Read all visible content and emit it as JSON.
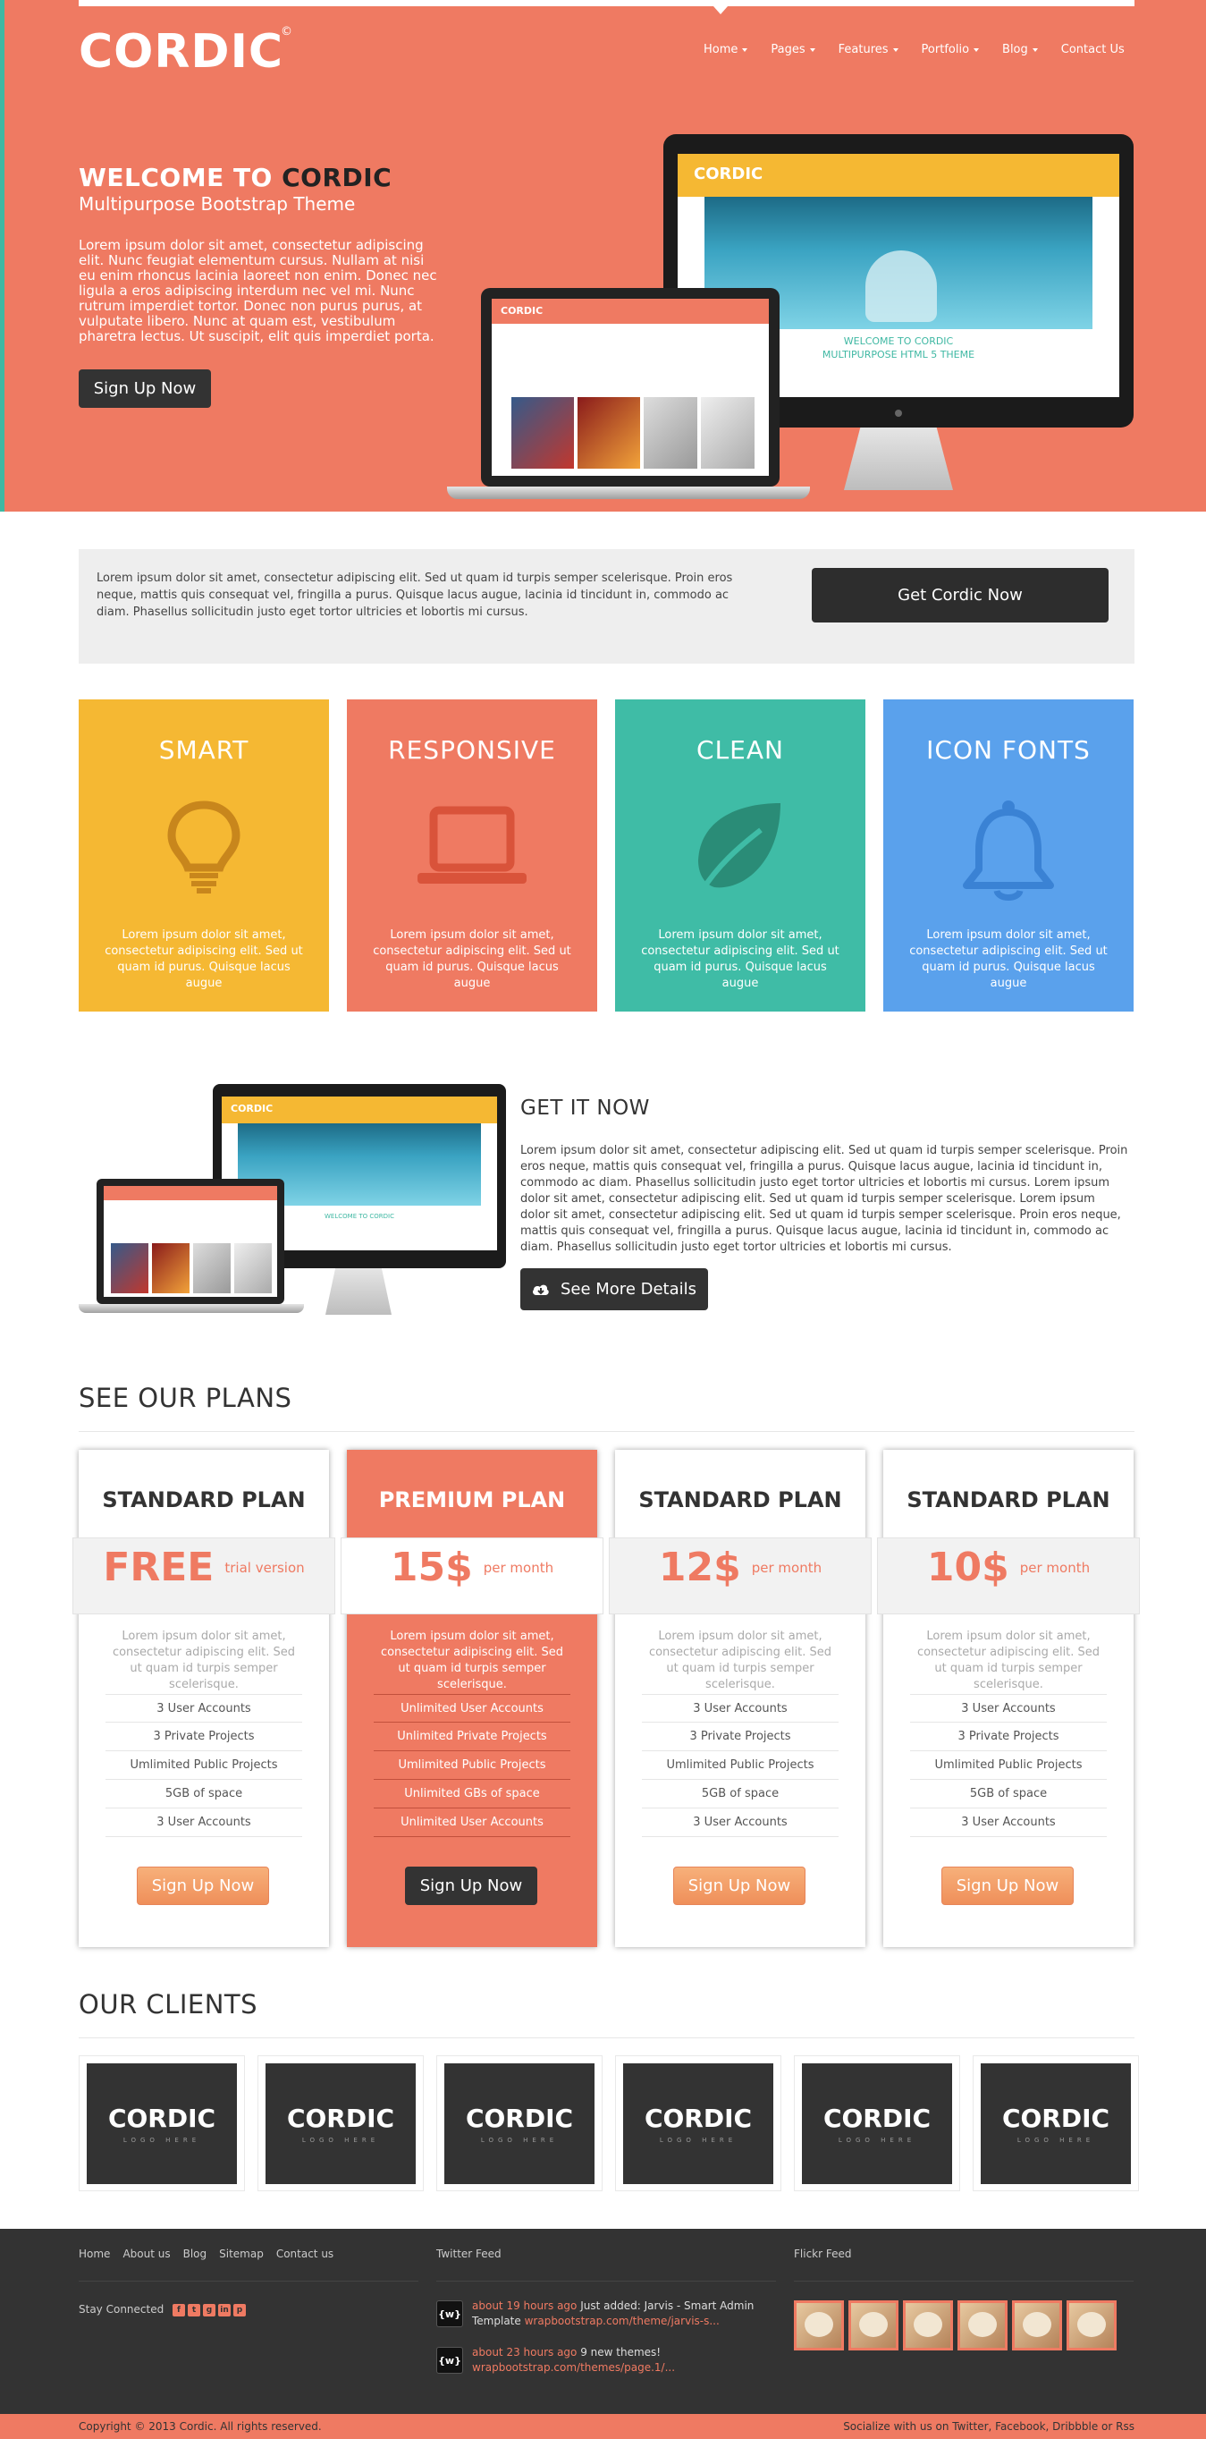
{
  "nav": {
    "logo": "CORDIC",
    "logo_mark": "©",
    "items": [
      {
        "label": "Home",
        "dropdown": true
      },
      {
        "label": "Pages",
        "dropdown": true
      },
      {
        "label": "Features",
        "dropdown": true
      },
      {
        "label": "Portfolio",
        "dropdown": true
      },
      {
        "label": "Blog",
        "dropdown": true
      },
      {
        "label": "Contact Us",
        "dropdown": false
      }
    ]
  },
  "hero": {
    "title_prefix": "WELCOME TO ",
    "title_brand": "CORDIC",
    "subtitle": "Multipurpose Bootstrap Theme",
    "body": "Lorem ipsum dolor sit amet, consectetur adipiscing elit. Nunc feugiat elementum cursus. Nullam at nisi eu enim rhoncus lacinia laoreet non enim. Donec nec ligula a eros adipiscing interdum nec vel mi. Nunc rutrum imperdiet tortor. Donec non purus purus, at vulputate libero. Nunc at quam est, vestibulum pharetra lectus. Ut suscipit, elit quis imperdiet porta.",
    "button": "Sign Up Now",
    "screen_brand": "CORDIC",
    "screen_caption_1": "WELCOME TO CORDIC",
    "screen_caption_2": "MULTIPURPOSE HTML 5 THEME"
  },
  "cta": {
    "text": "Lorem ipsum dolor sit amet, consectetur adipiscing elit. Sed ut quam id turpis semper scelerisque. Proin eros neque, mattis quis consequat vel, fringilla a purus. Quisque lacus augue, lacinia id tincidunt in, commodo ac diam. Phasellus sollicitudin justo eget tortor ultricies et lobortis mi cursus.",
    "button": "Get Cordic Now"
  },
  "features": [
    {
      "title": "SMART",
      "icon": "lightbulb-icon",
      "color": "#f5b833",
      "icon_color": "#c8861c",
      "body": "Lorem ipsum dolor sit amet, consectetur adipiscing elit. Sed ut quam id purus. Quisque lacus augue"
    },
    {
      "title": "RESPONSIVE",
      "icon": "laptop-icon",
      "color": "#ef7a62",
      "icon_color": "#d9533a",
      "body": "Lorem ipsum dolor sit amet, consectetur adipiscing elit. Sed ut quam id purus. Quisque lacus augue"
    },
    {
      "title": "CLEAN",
      "icon": "leaf-icon",
      "color": "#3fbca6",
      "icon_color": "#2a8c77",
      "body": "Lorem ipsum dolor sit amet, consectetur adipiscing elit. Sed ut quam id purus. Quisque lacus augue"
    },
    {
      "title": "ICON FONTS",
      "icon": "bell-icon",
      "color": "#5aa1ec",
      "icon_color": "#3a82d4",
      "body": "Lorem ipsum dolor sit amet, consectetur adipiscing elit. Sed ut quam id purus. Quisque lacus augue"
    }
  ],
  "get_it_now": {
    "title": "GET IT NOW",
    "body": "Lorem ipsum dolor sit amet, consectetur adipiscing elit. Sed ut quam id turpis semper scelerisque. Proin eros neque, mattis quis consequat vel, fringilla a purus. Quisque lacus augue, lacinia id tincidunt in, commodo ac diam. Phasellus sollicitudin justo eget tortor ultricies et lobortis mi cursus. Lorem ipsum dolor sit amet, consectetur adipiscing elit. Sed ut quam id turpis semper scelerisque. Lorem ipsum dolor sit amet, consectetur adipiscing elit. Sed ut quam id turpis semper scelerisque. Proin eros neque, mattis quis consequat vel, fringilla a purus. Quisque lacus augue, lacinia id tincidunt in, commodo ac diam. Phasellus sollicitudin justo eget tortor ultricies et lobortis mi cursus.",
    "button": "See More Details"
  },
  "plans": {
    "title": "SEE OUR PLANS",
    "items": [
      {
        "name": "STANDARD PLAN",
        "price": "FREE",
        "period": "trial version",
        "desc": "Lorem ipsum dolor sit amet, consectetur adipiscing elit. Sed ut quam id turpis semper scelerisque.",
        "features": [
          "3 User Accounts",
          "3 Private Projects",
          "Umlimited Public Projects",
          "5GB of space",
          "3 User Accounts"
        ],
        "button": "Sign Up Now",
        "premium": false
      },
      {
        "name": "PREMIUM PLAN",
        "price": "15$",
        "period": "per month",
        "desc": "Lorem ipsum dolor sit amet, consectetur adipiscing elit. Sed ut quam id turpis semper scelerisque.",
        "features": [
          "Unlimited User Accounts",
          "Unlimited Private Projects",
          "Umlimited Public Projects",
          "Unlimited GBs of space",
          "Unlimited User Accounts"
        ],
        "button": "Sign Up Now",
        "premium": true
      },
      {
        "name": "STANDARD PLAN",
        "price": "12$",
        "period": "per month",
        "desc": "Lorem ipsum dolor sit amet, consectetur adipiscing elit. Sed ut quam id turpis semper scelerisque.",
        "features": [
          "3 User Accounts",
          "3 Private Projects",
          "Umlimited Public Projects",
          "5GB of space",
          "3 User Accounts"
        ],
        "button": "Sign Up Now",
        "premium": false
      },
      {
        "name": "STANDARD PLAN",
        "price": "10$",
        "period": "per month",
        "desc": "Lorem ipsum dolor sit amet, consectetur adipiscing elit. Sed ut quam id turpis semper scelerisque.",
        "features": [
          "3 User Accounts",
          "3 Private Projects",
          "Umlimited Public Projects",
          "5GB of space",
          "3 User Accounts"
        ],
        "button": "Sign Up Now",
        "premium": false
      }
    ]
  },
  "clients": {
    "title": "OUR CLIENTS",
    "logos": [
      {
        "name": "CORDIC",
        "sub": "LOGO HERE"
      },
      {
        "name": "CORDIC",
        "sub": "LOGO HERE"
      },
      {
        "name": "CORDIC",
        "sub": "LOGO HERE"
      },
      {
        "name": "CORDIC",
        "sub": "LOGO HERE"
      },
      {
        "name": "CORDIC",
        "sub": "LOGO HERE"
      },
      {
        "name": "CORDIC",
        "sub": "LOGO HERE"
      }
    ]
  },
  "footer": {
    "links": [
      "Home",
      "About us",
      "Blog",
      "Sitemap",
      "Contact us"
    ],
    "stay_connected": "Stay Connected",
    "socials": [
      "facebook-icon",
      "twitter-icon",
      "google-plus-icon",
      "linkedin-icon",
      "pinterest-icon"
    ],
    "twitter_title": "Twitter Feed",
    "tweets": [
      {
        "time": "about 19 hours ago",
        "text": "Just added: Jarvis - Smart Admin Template",
        "link": "wrapbootstrap.com/theme/jarvis-s..."
      },
      {
        "time": "about 23 hours ago",
        "text": "9 new themes!",
        "link": "wrapbootstrap.com/themes/page.1/..."
      }
    ],
    "flickr_title": "Flickr Feed",
    "flickr_count": 6,
    "copyright": "Copyright © 2013 Cordic. All rights reserved.",
    "socialize": "Socialize with us on Twitter, Facebook, Dribbble or Rss"
  }
}
